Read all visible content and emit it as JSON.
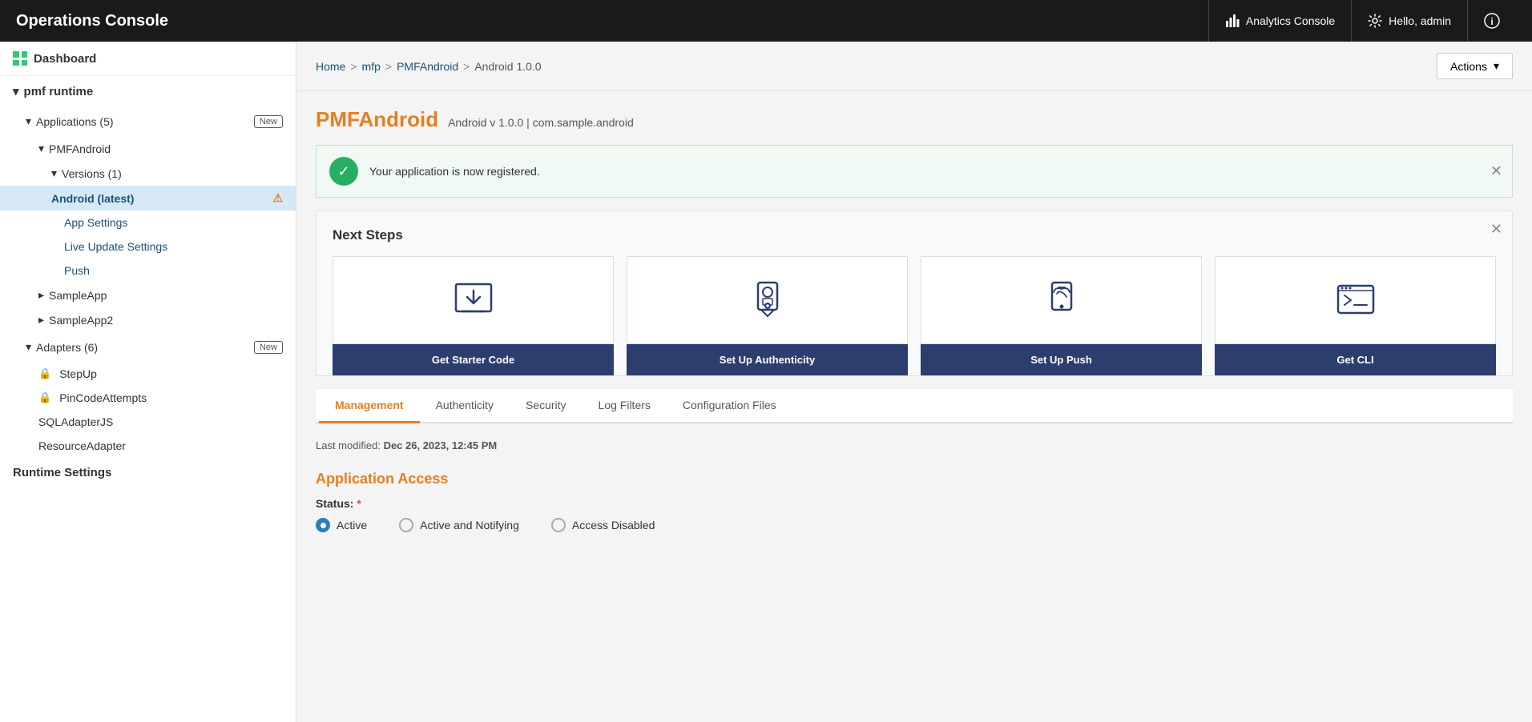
{
  "navbar": {
    "brand": "Operations Console",
    "analytics_label": "Analytics Console",
    "user_label": "Hello, admin",
    "info_icon": "info-icon"
  },
  "sidebar": {
    "dashboard_label": "Dashboard",
    "runtime": {
      "name": "pmf runtime",
      "applications": {
        "label": "Applications",
        "count": "5",
        "badge": "New",
        "items": [
          {
            "name": "PMFAndroid",
            "children": {
              "versions_label": "Versions",
              "versions_count": "1",
              "android_label": "Android (latest)",
              "has_warning": true,
              "links": [
                "App Settings",
                "Live Update Settings",
                "Push"
              ]
            }
          },
          {
            "name": "SampleApp"
          },
          {
            "name": "SampleApp2"
          }
        ]
      },
      "adapters": {
        "label": "Adapters",
        "count": "6",
        "badge": "New",
        "items": [
          {
            "name": "StepUp",
            "has_lock": true
          },
          {
            "name": "PinCodeAttempts",
            "has_lock": true
          },
          {
            "name": "SQLAdapterJS",
            "has_lock": false
          },
          {
            "name": "ResourceAdapter",
            "has_lock": false
          }
        ]
      },
      "runtime_settings": "Runtime Settings"
    }
  },
  "breadcrumb": {
    "items": [
      "Home",
      "mfp",
      "PMFAndroid"
    ],
    "current": "Android 1.0.0"
  },
  "actions_button": "Actions",
  "page": {
    "title": "PMFAndroid",
    "subtitle": "Android v 1.0.0 | com.sample.android",
    "banner_message": "Your application is now registered.",
    "next_steps": {
      "title": "Next Steps",
      "items": [
        {
          "label": "Get Starter Code",
          "icon": "download-icon"
        },
        {
          "label": "Set Up Authenticity",
          "icon": "authenticity-icon"
        },
        {
          "label": "Set Up Push",
          "icon": "push-icon"
        },
        {
          "label": "Get CLI",
          "icon": "cli-icon"
        }
      ]
    },
    "tabs": [
      {
        "label": "Management",
        "active": true
      },
      {
        "label": "Authenticity",
        "active": false
      },
      {
        "label": "Security",
        "active": false
      },
      {
        "label": "Log Filters",
        "active": false
      },
      {
        "label": "Configuration Files",
        "active": false
      }
    ],
    "management": {
      "last_modified_label": "Last modified:",
      "last_modified_value": "Dec 26, 2023, 12:45 PM",
      "application_access_title": "Application Access",
      "status_label": "Status:",
      "status_options": [
        {
          "label": "Active",
          "selected": true
        },
        {
          "label": "Active and Notifying",
          "selected": false
        },
        {
          "label": "Access Disabled",
          "selected": false
        }
      ]
    }
  }
}
